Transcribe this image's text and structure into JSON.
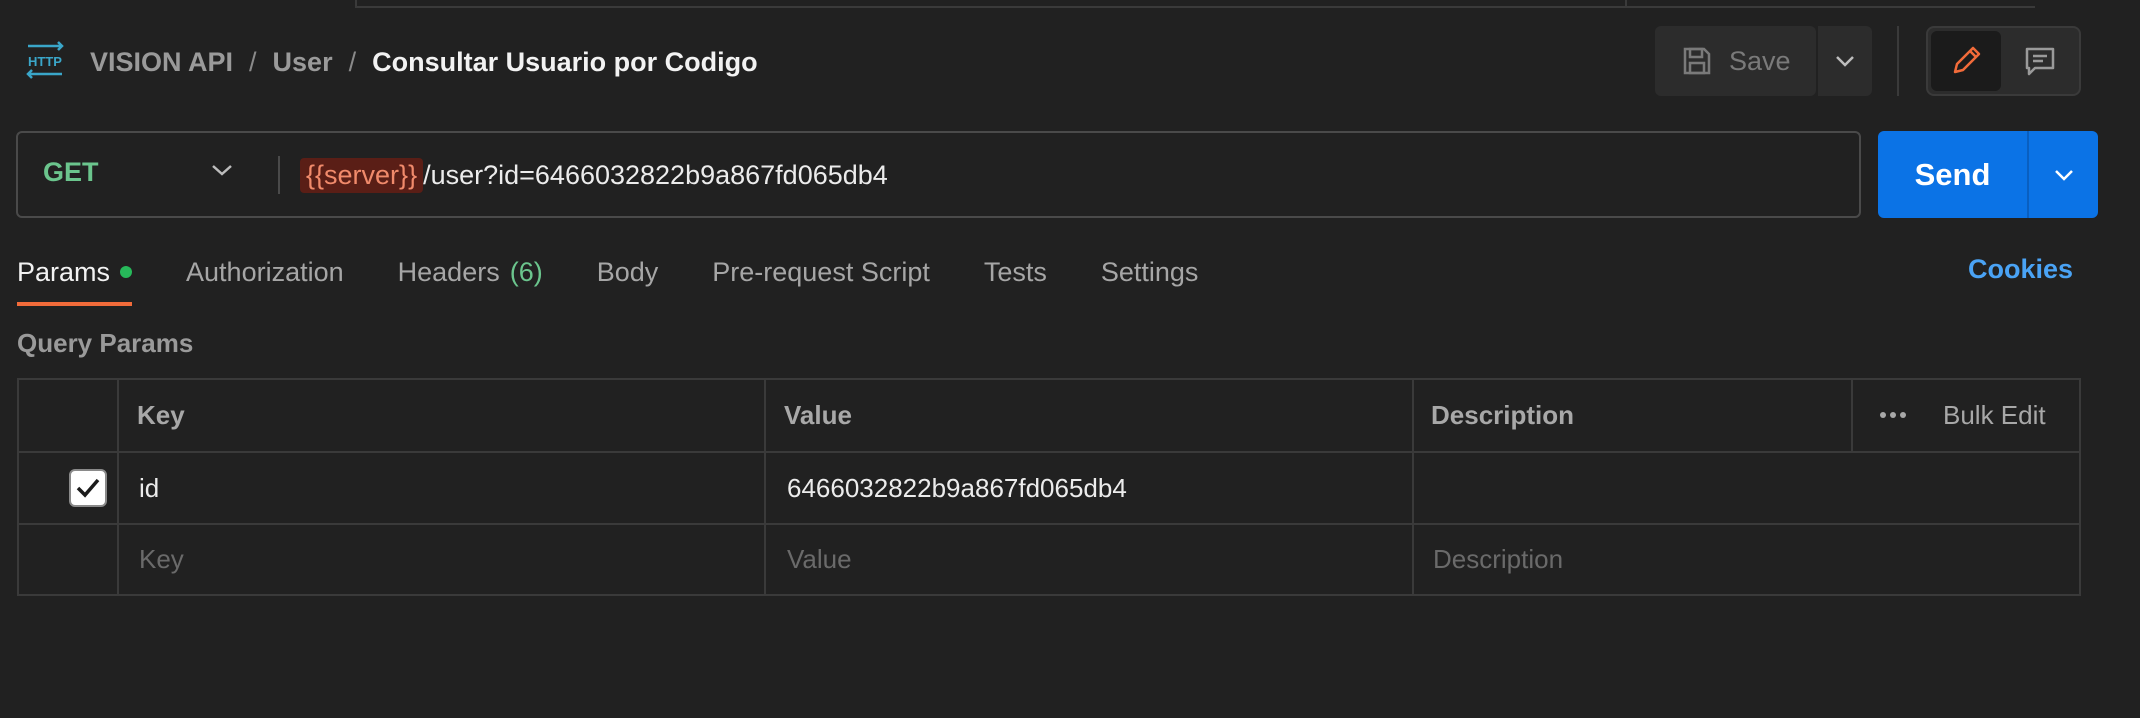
{
  "header": {
    "breadcrumb": [
      "VISION API",
      "User"
    ],
    "separator": "/",
    "current": "Consultar Usuario por Codigo",
    "icon": "http-icon",
    "save_label": "Save"
  },
  "request": {
    "method": "GET",
    "url_variable": "{{server}}",
    "url_path": "/user?id=6466032822b9a867fd065db4",
    "send_label": "Send"
  },
  "tabs": [
    {
      "label": "Params",
      "active": true,
      "indicator": "green-dot"
    },
    {
      "label": "Authorization"
    },
    {
      "label": "Headers",
      "count": "(6)"
    },
    {
      "label": "Body"
    },
    {
      "label": "Pre-request Script"
    },
    {
      "label": "Tests"
    },
    {
      "label": "Settings"
    }
  ],
  "cookies_label": "Cookies",
  "query_params": {
    "title": "Query Params",
    "columns": [
      "Key",
      "Value",
      "Description"
    ],
    "bulk_edit_label": "Bulk Edit",
    "rows": [
      {
        "checked": true,
        "key": "id",
        "value": "6466032822b9a867fd065db4",
        "description": ""
      }
    ],
    "placeholder": {
      "key": "Key",
      "value": "Value",
      "description": "Description"
    }
  },
  "colors": {
    "accent_orange": "#f26b3a",
    "send_blue": "#0b73e6",
    "method_green": "#6bc58d",
    "link_blue": "#4aa3f5"
  }
}
